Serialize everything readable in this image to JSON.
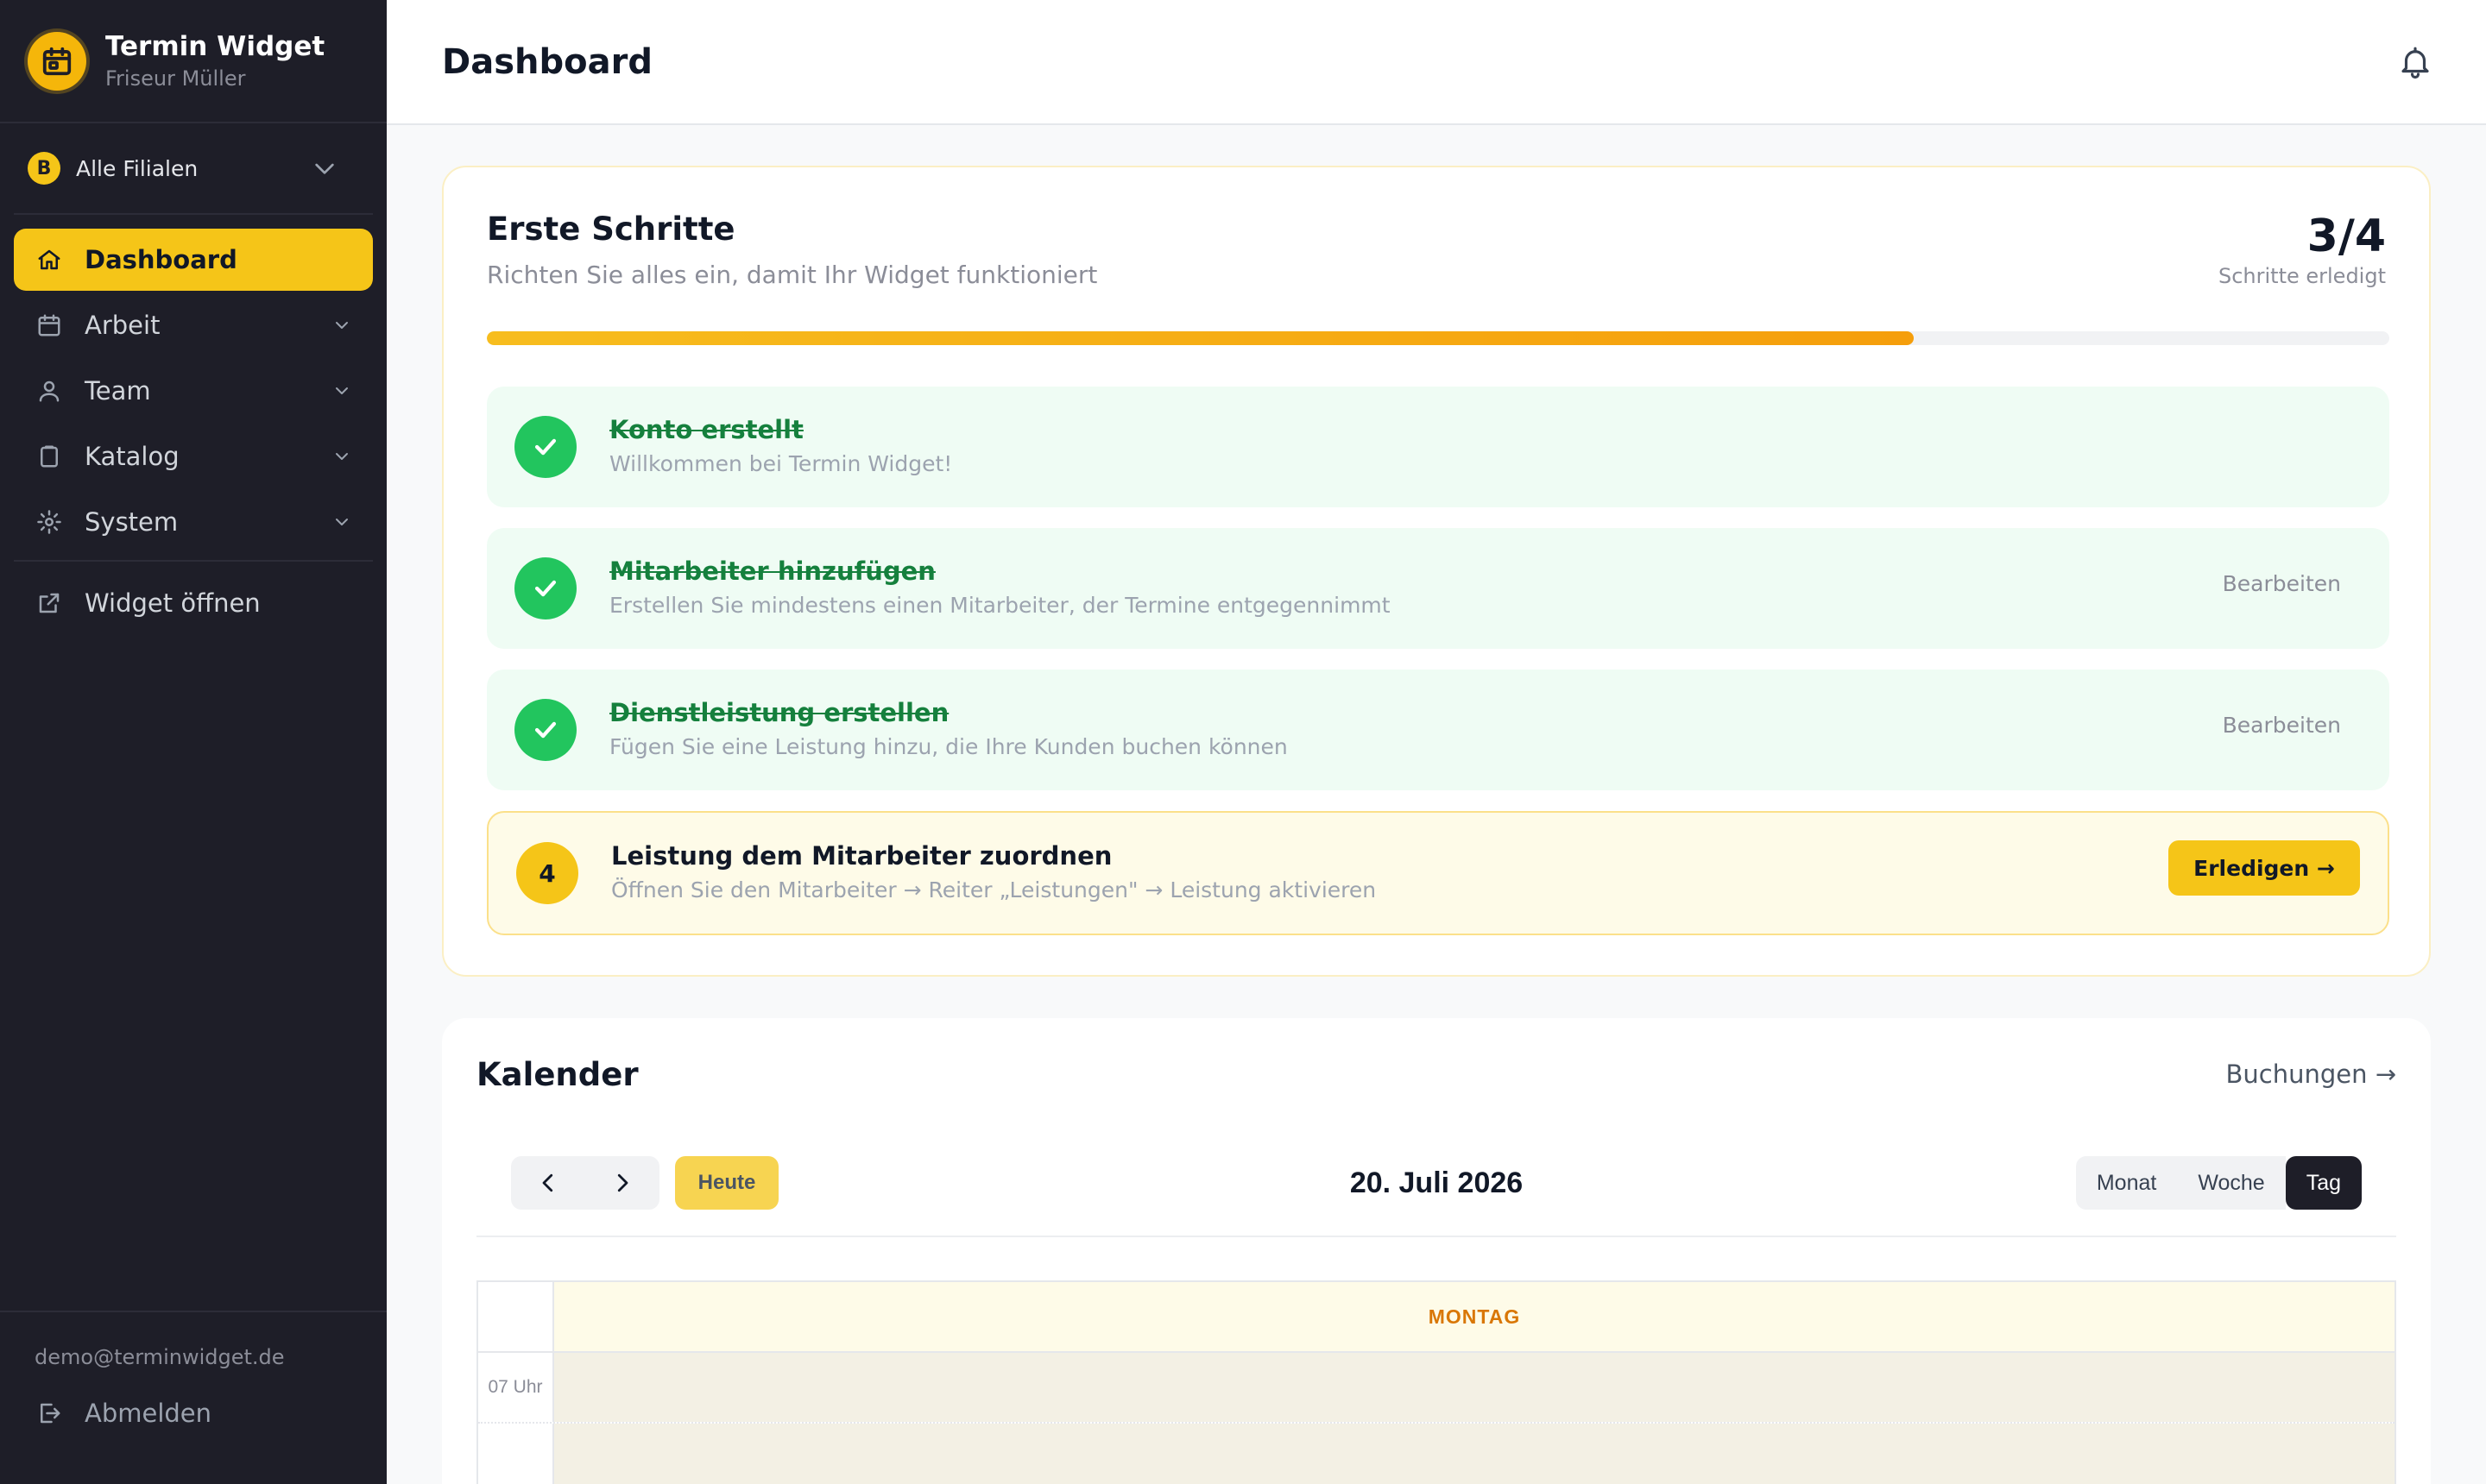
{
  "app": {
    "title": "Termin Widget",
    "subtitle": "Friseur Müller"
  },
  "branch": {
    "badge": "B",
    "label": "Alle Filialen"
  },
  "nav": {
    "dashboard": "Dashboard",
    "arbeit": "Arbeit",
    "team": "Team",
    "katalog": "Katalog",
    "system": "System",
    "widget": "Widget öffnen"
  },
  "user": {
    "email": "demo@terminwidget.de",
    "logout": "Abmelden"
  },
  "header": {
    "title": "Dashboard"
  },
  "onboarding": {
    "title": "Erste Schritte",
    "subtitle": "Richten Sie alles ein, damit Ihr Widget funktioniert",
    "count": "3/4",
    "count_label": "Schritte erledigt",
    "progress": 0.75,
    "steps": [
      {
        "title": "Konto erstellt",
        "desc": "Willkommen bei Termin Widget!",
        "done": true
      },
      {
        "title": "Mitarbeiter hinzufügen",
        "desc": "Erstellen Sie mindestens einen Mitarbeiter, der Termine entgegennimmt",
        "done": true,
        "action": "Bearbeiten"
      },
      {
        "title": "Dienstleistung erstellen",
        "desc": "Fügen Sie eine Leistung hinzu, die Ihre Kunden buchen können",
        "done": true,
        "action": "Bearbeiten"
      },
      {
        "number": "4",
        "title": "Leistung dem Mitarbeiter zuordnen",
        "desc": "Öffnen Sie den Mitarbeiter → Reiter „Leistungen\" → Leistung aktivieren",
        "done": false,
        "action": "Erledigen →"
      }
    ]
  },
  "calendar": {
    "title": "Kalender",
    "link": "Buchungen →",
    "today": "Heute",
    "date": "20. Juli 2026",
    "views": [
      "Monat",
      "Woche",
      "Tag"
    ],
    "active_view": "Tag",
    "day_header": "MONTAG",
    "hours": [
      "07 Uhr",
      ""
    ]
  },
  "colors": {
    "accent": "#f5c518",
    "sidebar": "#1e1e28",
    "success": "#22c55e"
  }
}
